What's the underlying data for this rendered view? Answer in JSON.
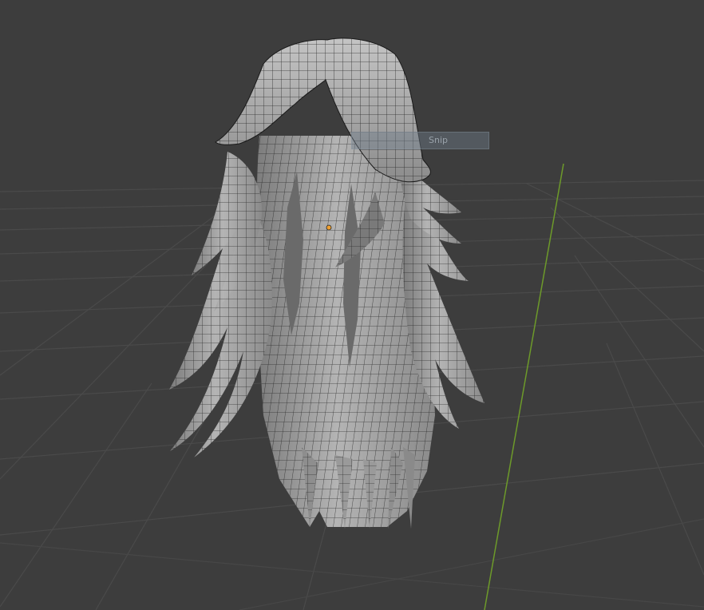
{
  "viewport": {
    "background_color": "#3d3d3d",
    "grid_color": "#4a4a4a",
    "axis_y_color": "#6d9a2a",
    "mesh_fill_color": "#9e9e9e",
    "mesh_wire_color": "#1a1a1a",
    "origin_color": "#f0a030",
    "object": "hair-mesh"
  },
  "tooltip": {
    "label": "Snip"
  }
}
